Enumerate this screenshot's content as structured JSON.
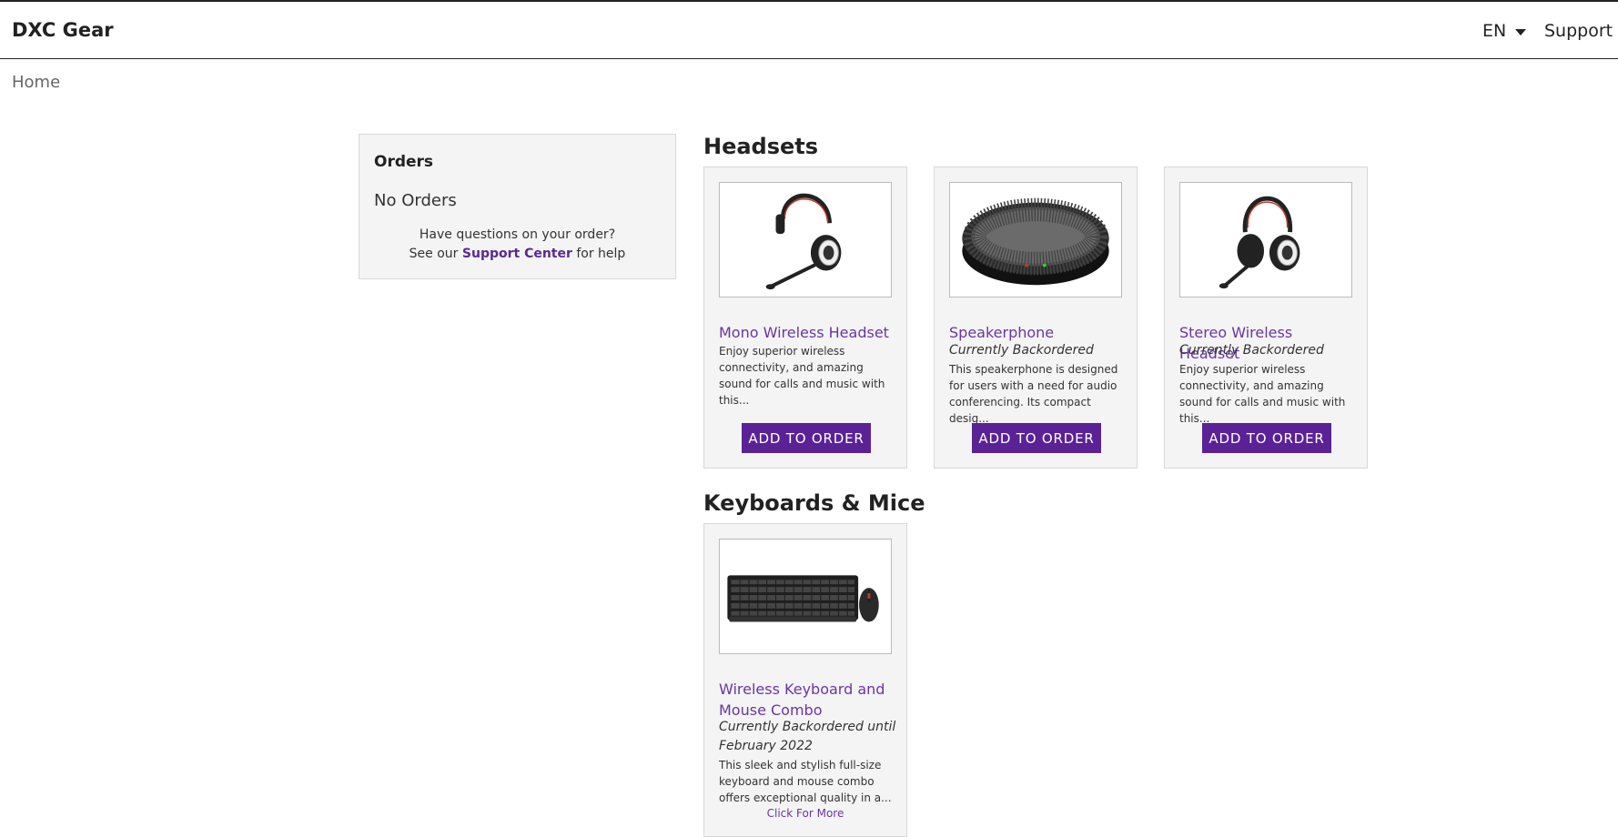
{
  "header": {
    "brand": "DXC Gear",
    "language": "EN",
    "support": "Support"
  },
  "breadcrumb": {
    "home": "Home"
  },
  "orders": {
    "title": "Orders",
    "empty": "No Orders",
    "help_line1": "Have questions on your order?",
    "help_prefix": "See our ",
    "help_link": "Support Center",
    "help_suffix": " for help"
  },
  "sections": [
    {
      "title": "Headsets",
      "products": [
        {
          "name": "Mono Wireless Headset",
          "status": "",
          "description": "Enjoy superior wireless connectivity, and amazing sound for calls and music with this...",
          "button": "ADD TO ORDER",
          "image": "mono-headset"
        },
        {
          "name": "Speakerphone",
          "status": "Currently Backordered",
          "description": "This speakerphone is designed for users with a need for audio conferencing. Its compact desig...",
          "button": "ADD TO ORDER",
          "image": "speakerphone"
        },
        {
          "name": "Stereo Wireless Headset",
          "status": "Currently Backordered",
          "description": "Enjoy superior wireless connectivity, and amazing sound for calls and music with this...",
          "button": "ADD TO ORDER",
          "image": "stereo-headset"
        }
      ]
    },
    {
      "title": "Keyboards & Mice",
      "products": [
        {
          "name": "Wireless Keyboard and Mouse Combo",
          "status": "Currently Backordered until February 2022",
          "description": "This sleek and stylish full-size keyboard and mouse combo offers exceptional quality in a...",
          "link": "Click For More",
          "image": "keyboard-mouse"
        }
      ]
    }
  ],
  "colors": {
    "accent": "#5b2196",
    "link": "#6a35a5",
    "card_bg": "#f4f4f4"
  }
}
